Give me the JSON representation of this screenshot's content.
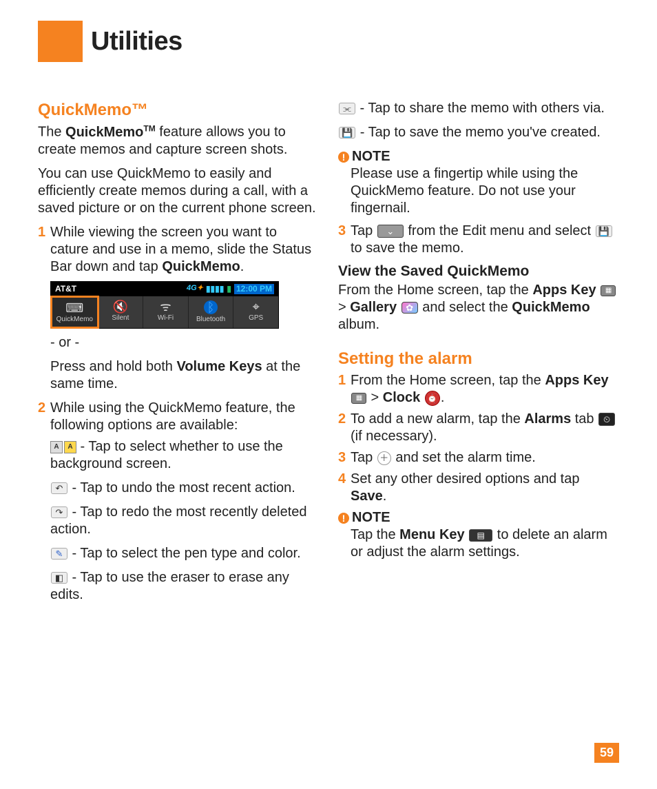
{
  "header": {
    "title": "Utilities"
  },
  "page_number": "59",
  "quickmemo": {
    "heading": "QuickMemo™",
    "intro1_a": "The ",
    "intro1_b": "QuickMemo",
    "intro1_c": " feature allows you to create memos and capture screen shots.",
    "intro2": "You can use QuickMemo to easily and efficiently create memos during a call, with a saved picture or on the current phone screen.",
    "step1_a": "While viewing the screen you want to cature and use in a memo, slide the Status Bar down and tap ",
    "step1_b": "QuickMemo",
    "step1_c": ".",
    "or": "- or -",
    "step1_alt_a": "Press and hold both ",
    "step1_alt_b": "Volume Keys",
    "step1_alt_c": " at the same time.",
    "step2": "While using the QuickMemo feature, the following options are available:",
    "opt_bg": " - Tap to select whether to use the background screen.",
    "opt_undo": " - Tap to undo the most recent action.",
    "opt_redo": " - Tap to redo the most recently deleted action.",
    "opt_pen": " - Tap to select the pen type and color.",
    "opt_eraser": " - Tap to use the eraser to erase any edits.",
    "opt_share": " - Tap to share the memo with others via.",
    "opt_save": " - Tap to save the memo you've created.",
    "note_label": "NOTE",
    "note_body": "Please use a fingertip while using the QuickMemo feature. Do not use your fingernail.",
    "step3_a": "Tap ",
    "step3_b": " from the Edit menu and select ",
    "step3_c": " to save the memo.",
    "view_heading": "View the Saved QuickMemo",
    "view_a": "From the Home screen, tap the ",
    "view_b": "Apps Key",
    "view_c": " > ",
    "view_d": "Gallery",
    "view_e": " and select the ",
    "view_f": "QuickMemo",
    "view_g": " album."
  },
  "alarm": {
    "heading": "Setting the alarm",
    "s1_a": "From the Home screen, tap the ",
    "s1_b": "Apps Key",
    "s1_c": " > ",
    "s1_d": "Clock",
    "s1_e": ".",
    "s2_a": "To add a new alarm, tap the ",
    "s2_b": "Alarms",
    "s2_c": " tab ",
    "s2_d": " (if necessary).",
    "s3_a": "Tap ",
    "s3_b": " and set the alarm time.",
    "s4_a": "Set any other desired options and tap ",
    "s4_b": "Save",
    "s4_c": ".",
    "note_label": "NOTE",
    "note_a": "Tap the ",
    "note_b": "Menu Key",
    "note_c": "  to delete an alarm or adjust the alarm settings."
  },
  "shot": {
    "carrier": "AT&T",
    "time": "12:00 PM",
    "items": [
      "QuickMemo",
      "Silent",
      "Wi-Fi",
      "Bluetooth",
      "GPS"
    ]
  }
}
